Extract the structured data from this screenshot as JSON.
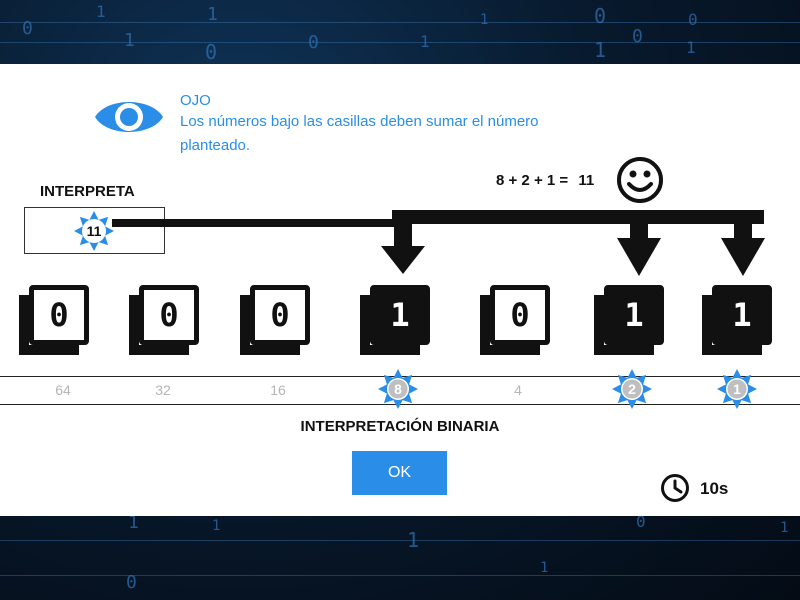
{
  "background": {
    "digits": [
      "0",
      "1",
      "1",
      "0",
      "1",
      "1",
      "1",
      "0",
      "1",
      "0",
      "0",
      "1",
      "0",
      "1",
      "1",
      "1",
      "0",
      "1",
      "0",
      "1"
    ]
  },
  "tip": {
    "icon": "eye-icon",
    "title": "OJO",
    "text": "Los números bajo las casillas deben sumar el número planteado."
  },
  "equation": {
    "text": "8 + 2 + 1 =",
    "result": "11",
    "icon": "smiley-icon"
  },
  "interpret": {
    "label": "INTERPRETA",
    "value": "11"
  },
  "bits": [
    {
      "value": "0",
      "weight": "64",
      "on": false
    },
    {
      "value": "0",
      "weight": "32",
      "on": false
    },
    {
      "value": "0",
      "weight": "16",
      "on": false
    },
    {
      "value": "1",
      "weight": "8",
      "on": true
    },
    {
      "value": "0",
      "weight": "4",
      "on": false
    },
    {
      "value": "1",
      "weight": "2",
      "on": true
    },
    {
      "value": "1",
      "weight": "1",
      "on": true
    }
  ],
  "binary_title": "INTERPRETACIÓN BINARIA",
  "ok_label": "OK",
  "timer": {
    "icon": "clock-icon",
    "value": "10s"
  },
  "colors": {
    "accent": "#2a8ee8",
    "dark": "#111111",
    "weight_text": "#b5b5b5",
    "white": "#ffffff"
  }
}
